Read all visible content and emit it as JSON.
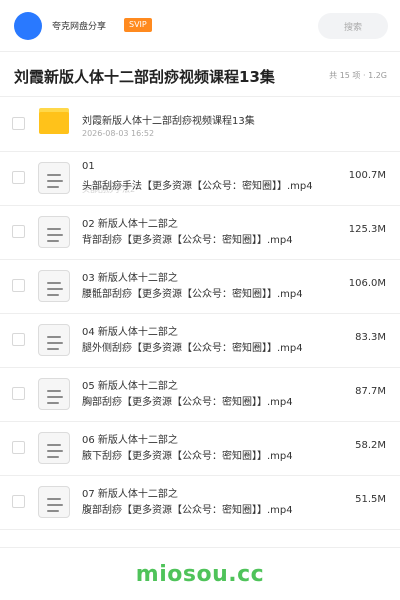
{
  "header": {
    "brand": "夸克网盘分享",
    "badge": "SVIP",
    "search_placeholder": "搜索",
    "accent_color": "#2979ff"
  },
  "title_bar": {
    "title": "刘霞新版人体十二部刮痧视频课程13集",
    "meta": "共 15 项 · 1.2G"
  },
  "folder": {
    "name": "刘霞新版人体十二部刮痧视频课程13集",
    "date": "2026-08-03 16:52",
    "icon": "folder-icon"
  },
  "files": [
    {
      "line1": "01",
      "line2": "头部刮痧手法【更多资源【公众号：密知圈】】.mp4",
      "ghost": "头部刮痧手法2",
      "size": "100.7M"
    },
    {
      "line1": "02 新版人体十二部之",
      "line2": "背部刮痧【更多资源【公众号：密知圈】】.mp4",
      "ghost": "",
      "size": "125.3M"
    },
    {
      "line1": "03 新版人体十二部之",
      "line2": "腰骶部刮痧【更多资源【公众号：密知圈】】.mp4",
      "ghost": "",
      "size": "106.0M"
    },
    {
      "line1": "04 新版人体十二部之",
      "line2": "腿外侧刮痧【更多资源【公众号：密知圈】】.mp4",
      "ghost": "",
      "size": "83.3M"
    },
    {
      "line1": "05 新版人体十二部之",
      "line2": "胸部刮痧【更多资源【公众号：密知圈】】.mp4",
      "ghost": "",
      "size": "87.7M"
    },
    {
      "line1": "06 新版人体十二部之",
      "line2": "腋下刮痧【更多资源【公众号：密知圈】】.mp4",
      "ghost": "",
      "size": "58.2M"
    },
    {
      "line1": "07 新版人体十二部之",
      "line2": "腹部刮痧【更多资源【公众号：密知圈】】.mp4",
      "ghost": "",
      "size": "51.5M"
    }
  ],
  "watermark": "miosou.cc",
  "watermark_color": "#4fc35a"
}
